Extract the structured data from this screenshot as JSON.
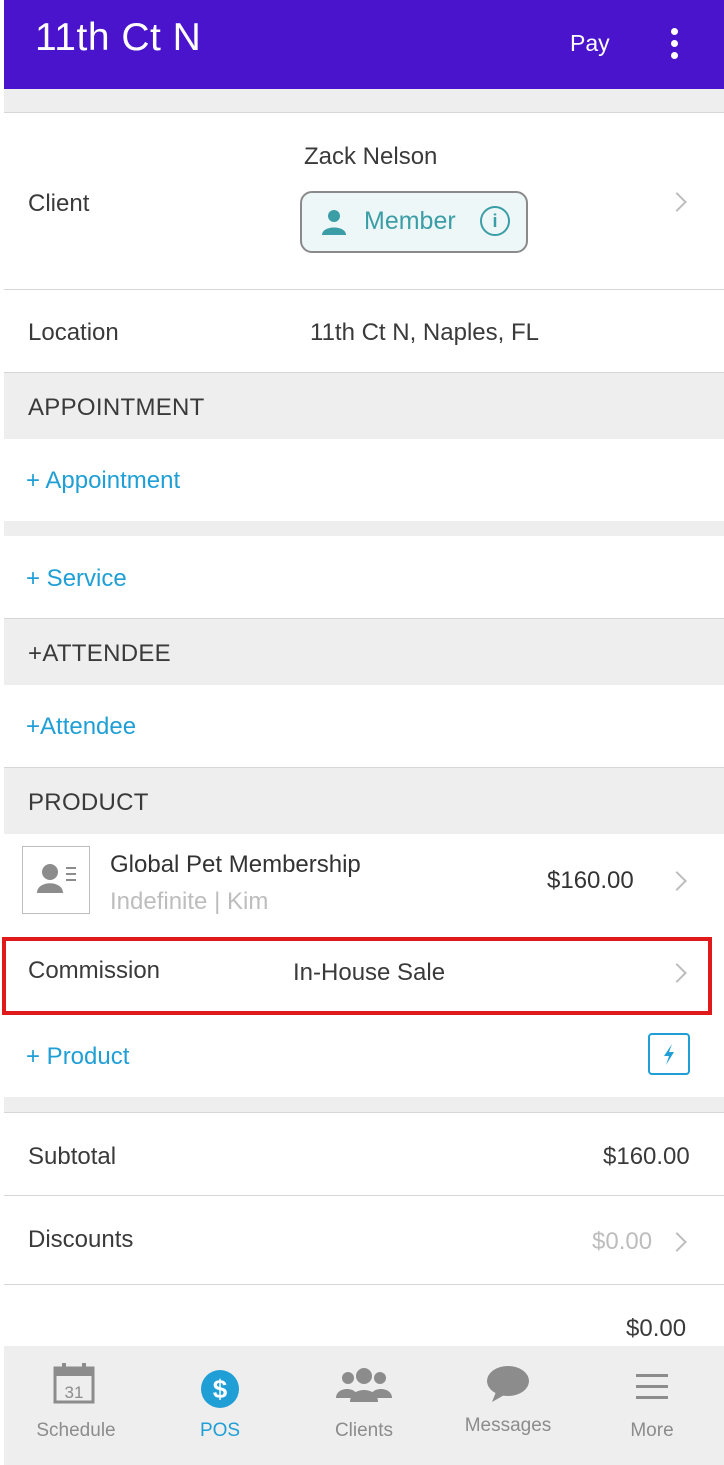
{
  "header": {
    "title": "11th Ct N",
    "pay_label": "Pay"
  },
  "client": {
    "label": "Client",
    "name": "Zack Nelson",
    "badge_label": "Member"
  },
  "location": {
    "label": "Location",
    "value": "11th Ct N, Naples, FL"
  },
  "appointment": {
    "section_title": "APPOINTMENT",
    "add_link": "+ Appointment"
  },
  "service": {
    "add_link": "+ Service"
  },
  "attendee": {
    "section_title": "+ATTENDEE",
    "add_link": "+Attendee"
  },
  "product": {
    "section_title": "PRODUCT",
    "items": [
      {
        "name": "Global Pet Membership",
        "subtitle": "Indefinite | Kim",
        "price": "$160.00"
      }
    ],
    "commission_label": "Commission",
    "commission_value": "In-House Sale",
    "add_link": "+ Product"
  },
  "totals": {
    "subtotal_label": "Subtotal",
    "subtotal_value": "$160.00",
    "discounts_label": "Discounts",
    "discounts_value": "$0.00",
    "partial_value": "$0.00"
  },
  "tabbar": {
    "tabs": [
      {
        "label": "Schedule",
        "icon": "calendar-icon",
        "date": "31"
      },
      {
        "label": "POS",
        "icon": "dollar-icon",
        "active": true
      },
      {
        "label": "Clients",
        "icon": "clients-icon"
      },
      {
        "label": "Messages",
        "icon": "chat-icon"
      },
      {
        "label": "More",
        "icon": "menu-icon"
      }
    ]
  },
  "colors": {
    "header_bg": "#4a14cc",
    "accent": "#1f9fd6",
    "member_teal": "#3b9ea6",
    "highlight_red": "#e0191b"
  }
}
